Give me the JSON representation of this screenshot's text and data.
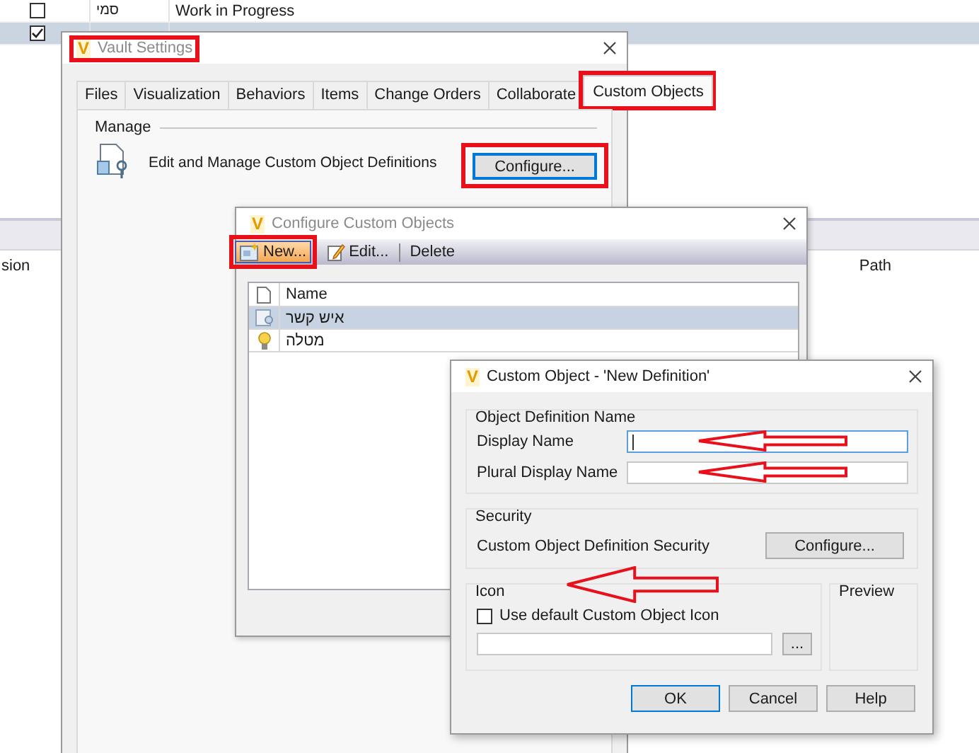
{
  "background": {
    "rows": [
      {
        "checked": false,
        "selected": false,
        "column_2": "סמי",
        "column_3": "Work in Progress"
      },
      {
        "checked": true,
        "selected": true
      }
    ],
    "columns": [
      "sion",
      "Path"
    ]
  },
  "vault_settings": {
    "logo": "V",
    "title": "Vault Settings",
    "title_highlighted": true,
    "tabs": [
      {
        "label": "Files",
        "selected": false,
        "highlighted": false
      },
      {
        "label": "Visualization",
        "selected": false,
        "highlighted": false
      },
      {
        "label": "Behaviors",
        "selected": false,
        "highlighted": false
      },
      {
        "label": "Items",
        "selected": false,
        "highlighted": false
      },
      {
        "label": "Change Orders",
        "selected": false,
        "highlighted": false
      },
      {
        "label": "Collaborate",
        "selected": false,
        "highlighted": false
      },
      {
        "label": "Custom Objects",
        "selected": true,
        "highlighted": true
      }
    ],
    "manage": {
      "heading": "Manage",
      "description": "Edit and Manage Custom Object Definitions",
      "button": {
        "label": "Configure...",
        "highlighted": true
      }
    }
  },
  "configure_custom_objects": {
    "logo": "V",
    "title": "Configure Custom Objects",
    "toolbar": [
      {
        "label": "New...",
        "kind": "new",
        "selected": true,
        "highlighted": true
      },
      {
        "label": "Edit...",
        "kind": "edit",
        "selected": false,
        "highlighted": false
      },
      {
        "label": "Delete",
        "kind": "delete",
        "selected": false,
        "highlighted": false
      }
    ],
    "columns": [
      "Name"
    ],
    "rows": [
      {
        "name": "איש קשר",
        "kind": "contact",
        "selected": true
      },
      {
        "name": "מטלה",
        "kind": "task",
        "selected": false
      }
    ]
  },
  "custom_object": {
    "logo": "V",
    "title": "Custom Object - 'New Definition'",
    "name_group": {
      "heading": "Object Definition Name",
      "fields": [
        {
          "label": "Display Name",
          "focused": true,
          "annotated": true
        },
        {
          "label": "Plural Display Name",
          "focused": false,
          "annotated": true
        }
      ]
    },
    "security": {
      "heading": "Security",
      "label": "Custom Object Definition Security",
      "button": "Configure..."
    },
    "icon_group": {
      "heading": "Icon",
      "annotated": true,
      "checkbox": {
        "label": "Use default Custom Object Icon",
        "checked": false
      },
      "browse_button": "..."
    },
    "preview": {
      "heading": "Preview"
    },
    "buttons": [
      {
        "label": "OK",
        "default": true
      },
      {
        "label": "Cancel",
        "default": false
      },
      {
        "label": "Help",
        "default": false
      }
    ]
  }
}
